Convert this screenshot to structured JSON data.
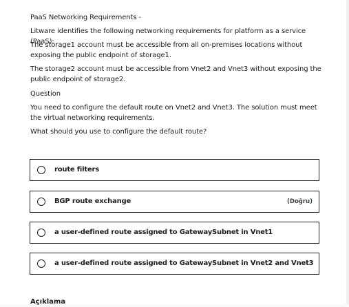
{
  "question": {
    "title": "PaaS Networking Requirements -",
    "intro": "Litware identifies the following networking requirements for platform as a service (PaaS):",
    "requirement_1": "The storage1 account must be accessible from all on-premises locations without exposing the public endpoint of storage1.",
    "requirement_2": "The storage2 account must be accessible from Vnet2 and Vnet3 without exposing the public endpoint of storage2.",
    "question_label": "Question",
    "question_text": "You need to configure the default route on Vnet2 and Vnet3. The solution must meet the virtual networking requirements.",
    "ask": "What should you use to configure the default route?"
  },
  "options": [
    {
      "label": "route filters",
      "badge": ""
    },
    {
      "label": "BGP route exchange",
      "badge": "(Doğru)"
    },
    {
      "label": "a user-defined route assigned to GatewaySubnet in Vnet1",
      "badge": ""
    },
    {
      "label": "a user-defined route assigned to GatewaySubnet in Vnet2 and Vnet3",
      "badge": ""
    }
  ],
  "explanation_heading": "Açıklama",
  "colors": {
    "text": "#1c1d1f",
    "border": "#1c1d1f",
    "background": "#ffffff"
  }
}
